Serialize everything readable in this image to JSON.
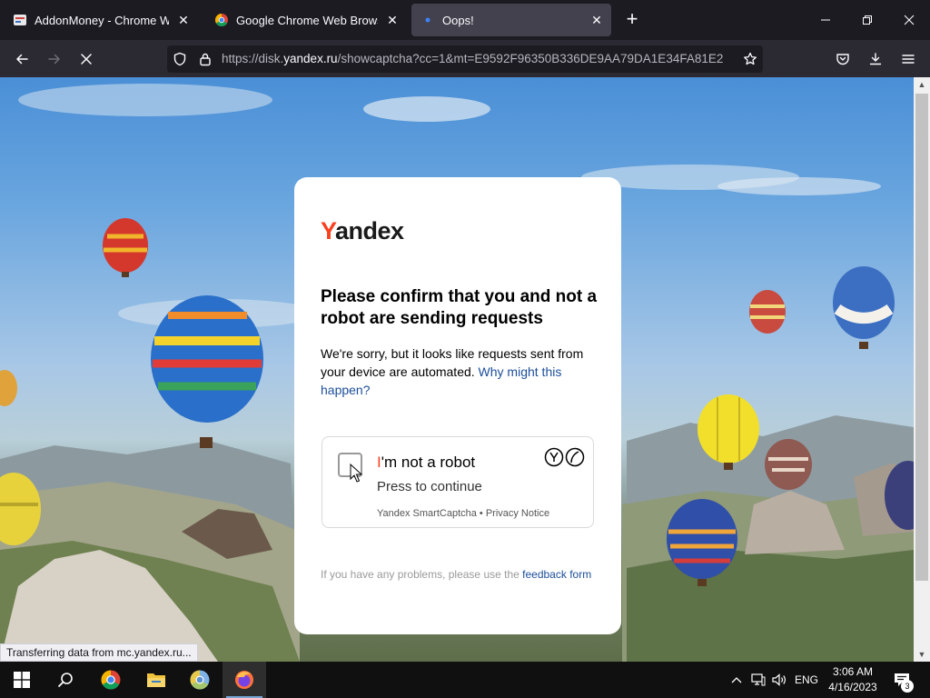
{
  "tabs": [
    {
      "label": "AddonMoney - Chrome Web St",
      "icon": "addonmoney-favicon",
      "active": false
    },
    {
      "label": "Google Chrome Web Browser",
      "icon": "chrome-favicon",
      "active": false
    },
    {
      "label": "Oops!",
      "icon": "loading-dot",
      "active": true
    }
  ],
  "url": {
    "prefix": "https://disk.",
    "domain": "yandex.ru",
    "path": "/showcaptcha?cc=1&mt=E9592F96350B336DE9AA79DA1E34FA81E2"
  },
  "card": {
    "logo_first": "Y",
    "logo_rest": "andex",
    "title": "Please confirm that you and not a robot are sending requests",
    "text": "We're sorry, but it looks like requests sent from your device are automated.",
    "text_link": "Why might this happen?",
    "captcha": {
      "title_first": "I",
      "title_rest": "'m not a robot",
      "subtitle": "Press to continue",
      "footer": "Yandex SmartCaptcha • Privacy Notice"
    },
    "footer_text": "If you have any problems, please use the",
    "footer_link": "feedback form"
  },
  "status_bar": "Transferring data from mc.yandex.ru...",
  "taskbar": {
    "language": "ENG",
    "time": "3:06 AM",
    "date": "4/16/2023",
    "notification_count": "3"
  },
  "colors": {
    "yandex_red": "#fc3f1d",
    "link_blue": "#1b4e9a",
    "tab_active": "#42414d",
    "toolbar": "#2b2a33"
  }
}
